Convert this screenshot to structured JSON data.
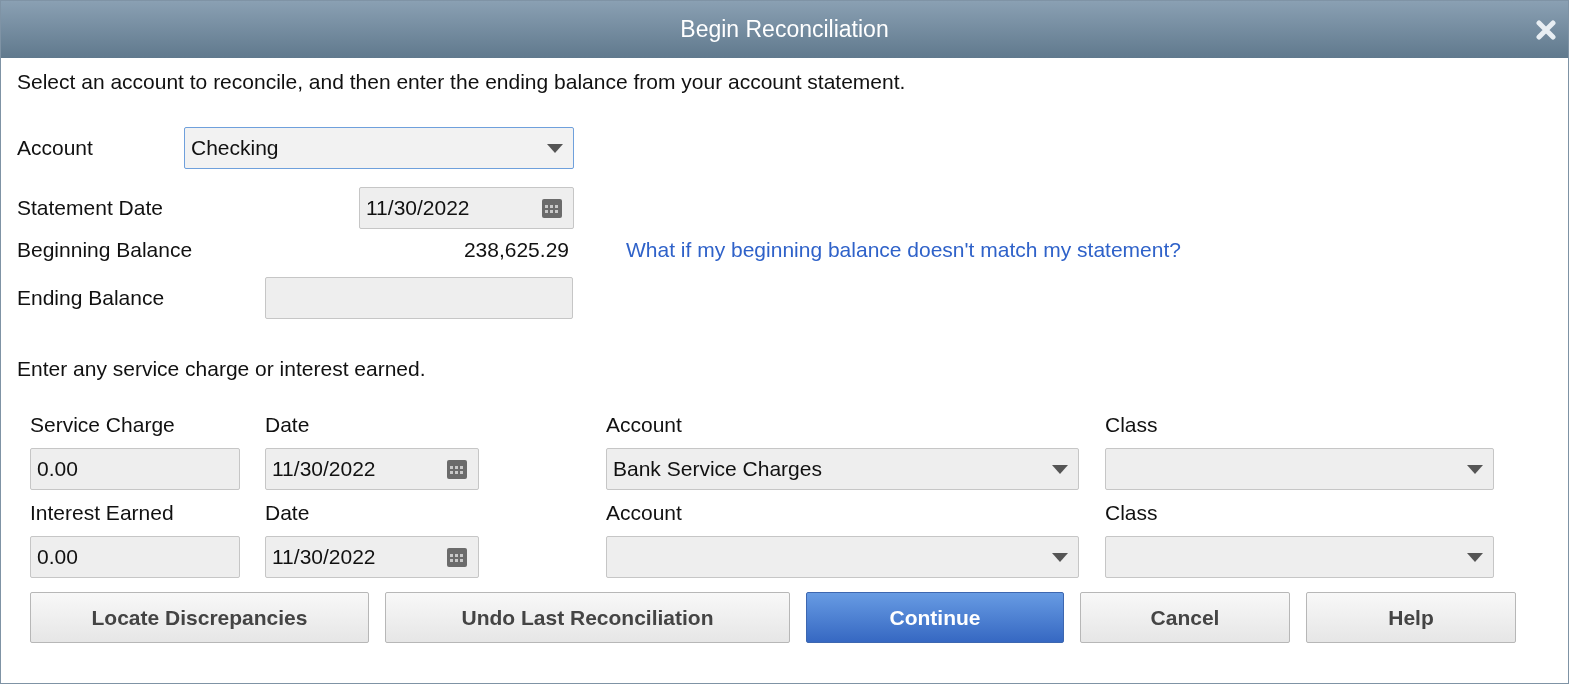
{
  "window": {
    "title": "Begin Reconciliation"
  },
  "intro": "Select an account to reconcile, and then enter the ending balance from your account statement.",
  "account": {
    "label": "Account",
    "value": "Checking",
    "focused": true
  },
  "statement_date": {
    "label": "Statement Date",
    "value": "11/30/2022"
  },
  "beginning_balance": {
    "label": "Beginning Balance",
    "value": "238,625.29"
  },
  "help_link": "What if my beginning balance doesn't match my statement?",
  "ending_balance": {
    "label": "Ending Balance"
  },
  "adjust_prompt": "Enter any service charge or interest earned.",
  "adjustments": [
    {
      "amount_label": "Service Charge",
      "amount": "0.00",
      "date_label": "Date",
      "date": "11/30/2022",
      "account_label": "Account",
      "account": "Bank Service Charges",
      "class_label": "Class"
    },
    {
      "amount_label": "Interest Earned",
      "amount": "0.00",
      "date_label": "Date",
      "date": "11/30/2022",
      "account_label": "Account",
      "class_label": "Class"
    }
  ],
  "buttons": [
    {
      "label": "Locate Discrepancies",
      "primary": false
    },
    {
      "label": "Undo Last Reconciliation",
      "primary": false
    },
    {
      "label": "Continue",
      "primary": true
    },
    {
      "label": "Cancel",
      "primary": false
    },
    {
      "label": "Help",
      "primary": false
    }
  ]
}
